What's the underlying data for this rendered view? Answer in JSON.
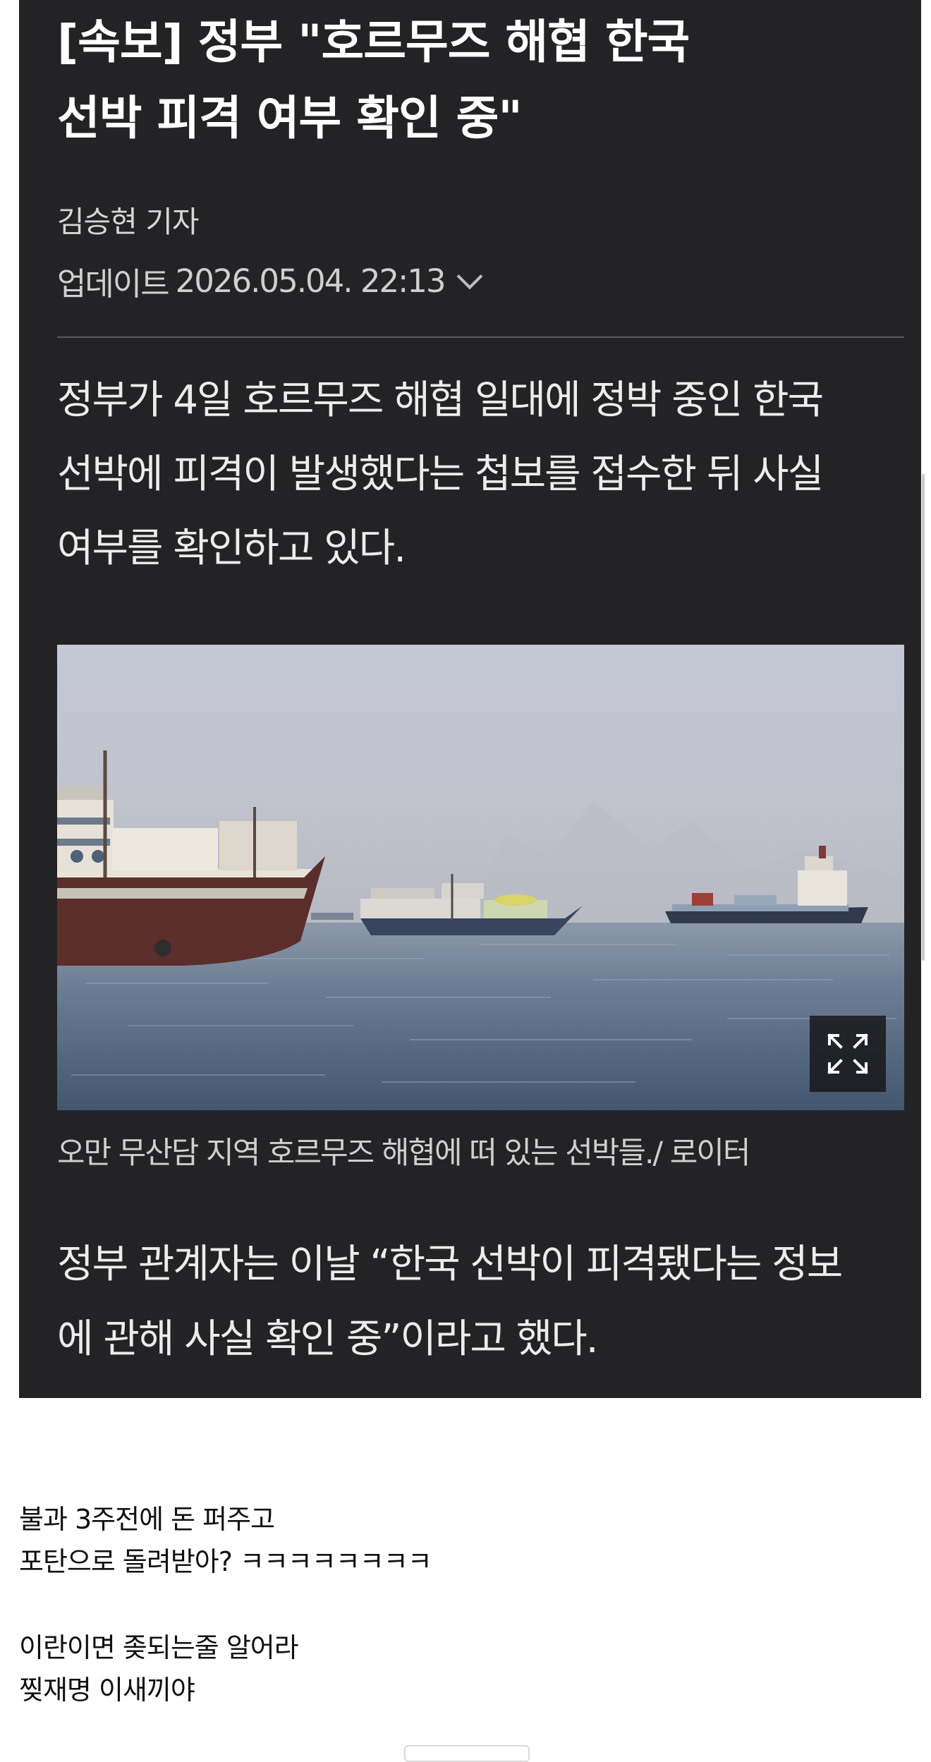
{
  "article": {
    "headline": "[속보] 정부 \"호르무즈 해협 한국\n선박 피격 여부 확인 중\"",
    "byline": "김승현 기자",
    "update_label": "업데이트",
    "update_time": "2026.05.04. 22:13",
    "lead": "정부가 4일 호르무즈 해협 일대에 정박 중인 한국\n선박에 피격이 발생했다는 첩보를 접수한 뒤 사실\n여부를 확인하고 있다.",
    "photo": {
      "alt": "호르무즈 해협에 떠 있는 선박들",
      "expand_icon": "expand-icon"
    },
    "caption": "오만 무산담 지역 호르무즈 해협에 떠 있는 선박들./ 로이터",
    "paragraph2": "정부 관계자는 이날 “한국 선박이 피격됐다는 정보\n에 관해 사실 확인 중”이라고 했다."
  },
  "comments": [
    "불과 3주전에 돈 퍼주고\n포탄으로 돌려받아? ㅋㅋㅋㅋㅋㅋㅋㅋ",
    "이란이면 좆되는줄 알어라\n찢재명 이새끼야"
  ],
  "colors": {
    "card_background": "#232325",
    "headline_text": "#ffffff",
    "body_text": "#ececec",
    "meta_text": "#cfcfcf",
    "page_background": "#ffffff"
  }
}
